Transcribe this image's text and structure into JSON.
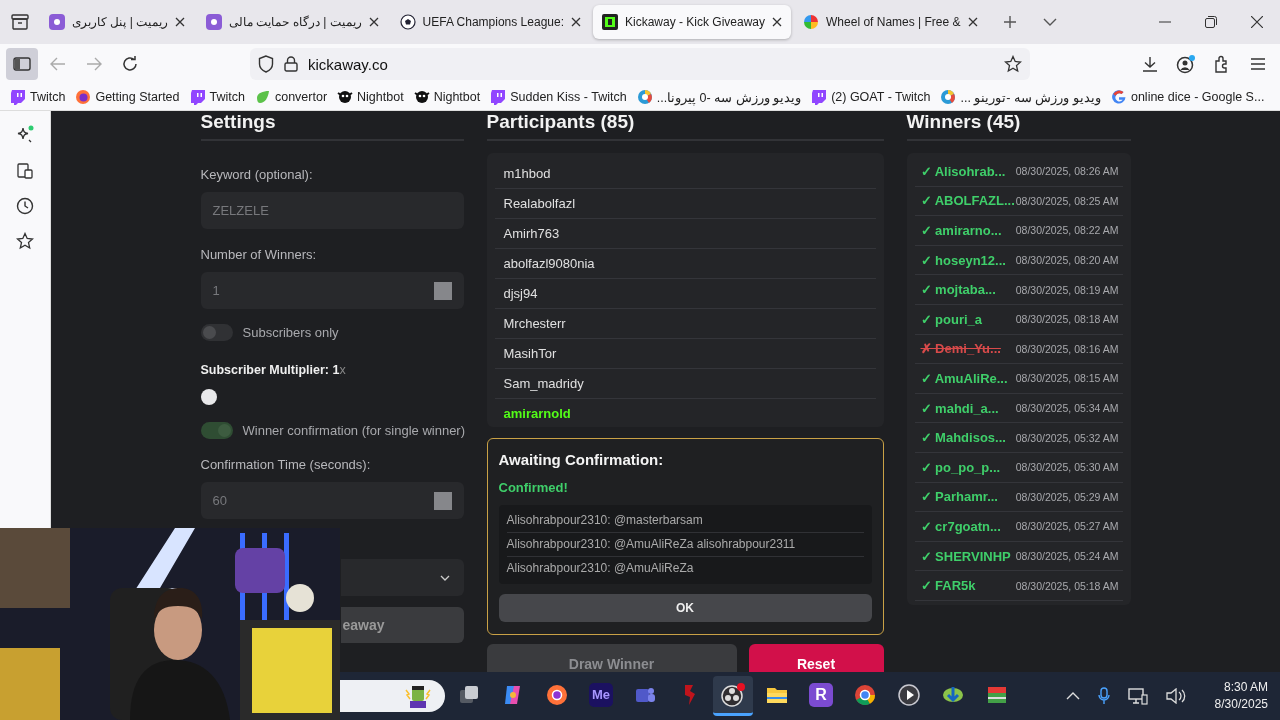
{
  "browser": {
    "tabs": [
      {
        "kind": "r",
        "title": "ریمیت | پنل کاربری",
        "selected": false
      },
      {
        "kind": "r",
        "title": "ریمیت | درگاه حمایت مالی",
        "selected": false
      },
      {
        "kind": "ball",
        "title": "UEFA Champions League:",
        "selected": false
      },
      {
        "kind": "kick",
        "title": "Kickaway - Kick Giveaway",
        "selected": true
      },
      {
        "kind": "wheel",
        "title": "Wheel of Names | Free &",
        "selected": false
      }
    ],
    "url": "kickaway.co",
    "bookmarks": [
      {
        "kind": "twitch",
        "label": "Twitch"
      },
      {
        "kind": "firefox",
        "label": "Getting Started"
      },
      {
        "kind": "twitch",
        "label": "Twitch"
      },
      {
        "kind": "leaf",
        "label": "convertor"
      },
      {
        "kind": "bot",
        "label": "Nightbot"
      },
      {
        "kind": "bot",
        "label": "Nightbot"
      },
      {
        "kind": "twitch",
        "label": "Sudden Kiss - Twitch"
      },
      {
        "kind": "v3",
        "label": "ویدیو ورزش سه -0 پیرونا..."
      },
      {
        "kind": "twitch",
        "label": "(2) GOAT - Twitch"
      },
      {
        "kind": "v3",
        "label": "ویدیو ورزش سه -تورینو ..."
      },
      {
        "kind": "google",
        "label": "online dice - Google S..."
      }
    ]
  },
  "settings": {
    "title": "Settings",
    "keyword": {
      "label": "Keyword (optional):",
      "value": "ZELZELE"
    },
    "winners_count": {
      "label": "Number of Winners:",
      "value": "1"
    },
    "subscribers_only": {
      "label": "Subscribers only",
      "on": false
    },
    "multiplier": {
      "label": "**Subscriber Multiplier: 1**x"
    },
    "confirmation": {
      "label": "Winner confirmation (for single winner)",
      "on": true
    },
    "confirmation_time": {
      "label": "Confirmation Time (seconds):",
      "value": "60"
    },
    "start_button": "eaway"
  },
  "participants": {
    "title": "Participants (85)",
    "items": [
      {
        "name": "m1hbod",
        "selected": false
      },
      {
        "name": "Realabolfazl",
        "selected": false
      },
      {
        "name": "Amirh763",
        "selected": false
      },
      {
        "name": "abolfazl9080nia",
        "selected": false
      },
      {
        "name": "djsj94",
        "selected": false
      },
      {
        "name": "Mrchesterr",
        "selected": false
      },
      {
        "name": "MasihTor",
        "selected": false
      },
      {
        "name": "Sam_madridy",
        "selected": false
      },
      {
        "name": "amirarnold",
        "selected": true
      }
    ],
    "awaiting": {
      "title": "Awaiting Confirmation:",
      "status": "Confirmed!",
      "messages": [
        "Alisohrabpour2310: @masterbarsam",
        "Alisohrabpour2310: @AmuAliReZa alisohrabpour2311",
        "Alisohrabpour2310: @AmuAliReZa"
      ],
      "ok": "OK"
    },
    "draw_button": "Draw Winner",
    "reset_button": "Reset"
  },
  "winners": {
    "title": "Winners (45)",
    "items": [
      {
        "mark": "✓",
        "name": "Alisohrab...",
        "time": "08/30/2025, 08:26 AM",
        "confirmed": true
      },
      {
        "mark": "✓",
        "name": "ABOLFAZL...",
        "time": "08/30/2025, 08:25 AM",
        "confirmed": true
      },
      {
        "mark": "✓",
        "name": "amirarno...",
        "time": "08/30/2025, 08:22 AM",
        "confirmed": true
      },
      {
        "mark": "✓",
        "name": "hoseyn12...",
        "time": "08/30/2025, 08:20 AM",
        "confirmed": true
      },
      {
        "mark": "✓",
        "name": "mojtaba...",
        "time": "08/30/2025, 08:19 AM",
        "confirmed": true
      },
      {
        "mark": "✓",
        "name": "pouri_a",
        "time": "08/30/2025, 08:18 AM",
        "confirmed": true
      },
      {
        "mark": "✗",
        "name": "Demi_Yu...",
        "time": "08/30/2025, 08:16 AM",
        "confirmed": false
      },
      {
        "mark": "✓",
        "name": "AmuAliRe...",
        "time": "08/30/2025, 08:15 AM",
        "confirmed": true
      },
      {
        "mark": "✓",
        "name": "mahdi_a...",
        "time": "08/30/2025, 05:34 AM",
        "confirmed": true
      },
      {
        "mark": "✓",
        "name": "Mahdisos...",
        "time": "08/30/2025, 05:32 AM",
        "confirmed": true
      },
      {
        "mark": "✓",
        "name": "po_po_p...",
        "time": "08/30/2025, 05:30 AM",
        "confirmed": true
      },
      {
        "mark": "✓",
        "name": "Parhamr...",
        "time": "08/30/2025, 05:29 AM",
        "confirmed": true
      },
      {
        "mark": "✓",
        "name": "cr7goatn...",
        "time": "08/30/2025, 05:27 AM",
        "confirmed": true
      },
      {
        "mark": "✓",
        "name": "SHERVINHP",
        "time": "08/30/2025, 05:24 AM",
        "confirmed": true
      },
      {
        "mark": "✓",
        "name": "FAR5k",
        "time": "08/30/2025, 05:18 AM",
        "confirmed": true
      }
    ]
  },
  "taskbar": {
    "apps": [
      {
        "kind": "search",
        "selected": false
      },
      {
        "kind": "taskview",
        "selected": false
      },
      {
        "kind": "copilot",
        "selected": false
      },
      {
        "kind": "firefox",
        "selected": false
      },
      {
        "kind": "media",
        "label": "Me",
        "selected": false
      },
      {
        "kind": "teams",
        "selected": false
      },
      {
        "kind": "redapp",
        "selected": false
      },
      {
        "kind": "obs",
        "selected": true
      },
      {
        "kind": "folder",
        "selected": false
      },
      {
        "kind": "rapp",
        "label": "R",
        "selected": false
      },
      {
        "kind": "chrome",
        "selected": false
      },
      {
        "kind": "play",
        "selected": false
      },
      {
        "kind": "idm",
        "selected": false
      },
      {
        "kind": "drive",
        "selected": false
      }
    ],
    "time": "8:30 AM",
    "date": "8/30/2025"
  }
}
